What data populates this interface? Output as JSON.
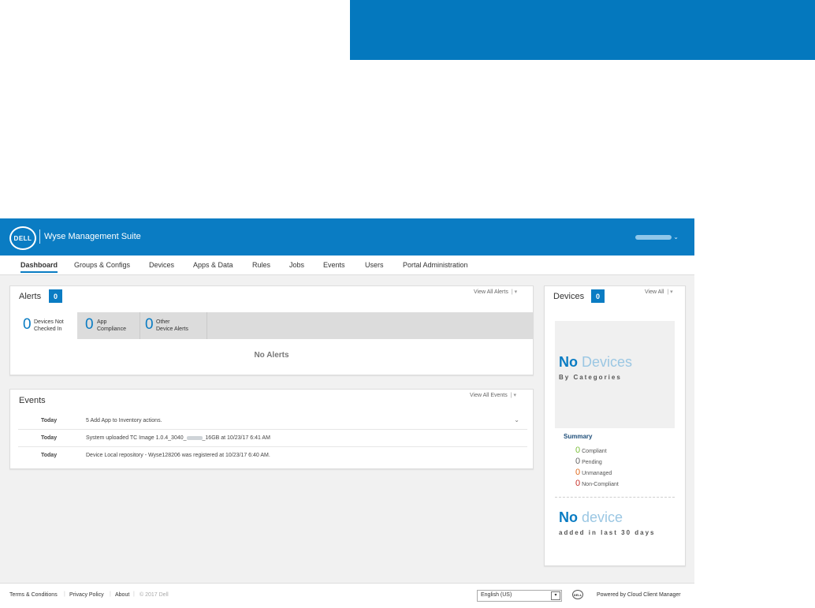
{
  "colors": {
    "brand": "#0a7cc3",
    "compliant": "#7bbf3a",
    "pending": "#666666",
    "unmanaged": "#e06b1f",
    "non_compliant": "#c7312a"
  },
  "header": {
    "logo": "DELL",
    "title": "Wyse Management Suite",
    "user_caret": "⌄"
  },
  "nav": {
    "items": [
      "Dashboard",
      "Groups & Configs",
      "Devices",
      "Apps & Data",
      "Rules",
      "Jobs",
      "Events",
      "Users",
      "Portal Administration"
    ],
    "active": "Dashboard"
  },
  "alerts": {
    "title": "Alerts",
    "count": "0",
    "view_all": "View All Alerts",
    "tabs": [
      {
        "num": "0",
        "line1": "Devices Not",
        "line2": "Checked In"
      },
      {
        "num": "0",
        "line1": "App",
        "line2": "Compliance"
      },
      {
        "num": "0",
        "line1": "Other",
        "line2": "Device Alerts"
      }
    ],
    "empty_text": "No Alerts"
  },
  "events": {
    "title": "Events",
    "view_all": "View All Events",
    "rows": [
      {
        "when": "Today",
        "what": "5 Add App to Inventory actions."
      },
      {
        "when": "Today",
        "what_pre": "System uploaded TC Image 1.0.4_3040_",
        "what_post": "_16GB at 10/23/17 6:41 AM"
      },
      {
        "when": "Today",
        "what": "Device Local repository - Wyse128206 was registered at 10/23/17 6:40 AM."
      }
    ]
  },
  "devices": {
    "title": "Devices",
    "count": "0",
    "view_all": "View All",
    "no_devices_bold": "No",
    "no_devices_light": "Devices",
    "by_categories": "By Categories",
    "summary_title": "Summary",
    "summary": [
      {
        "num": "0",
        "label": "Compliant"
      },
      {
        "num": "0",
        "label": "Pending"
      },
      {
        "num": "0",
        "label": "Unmanaged"
      },
      {
        "num": "0",
        "label": "Non-Compliant"
      }
    ],
    "no_device_bold": "No",
    "no_device_light": "device",
    "added_text": "added in last 30 days"
  },
  "footer": {
    "terms": "Terms & Conditions",
    "privacy": "Privacy Policy",
    "about": "About",
    "copyright": "© 2017 Dell",
    "language": "English (US)",
    "powered": "Powered by Cloud Client Manager"
  }
}
